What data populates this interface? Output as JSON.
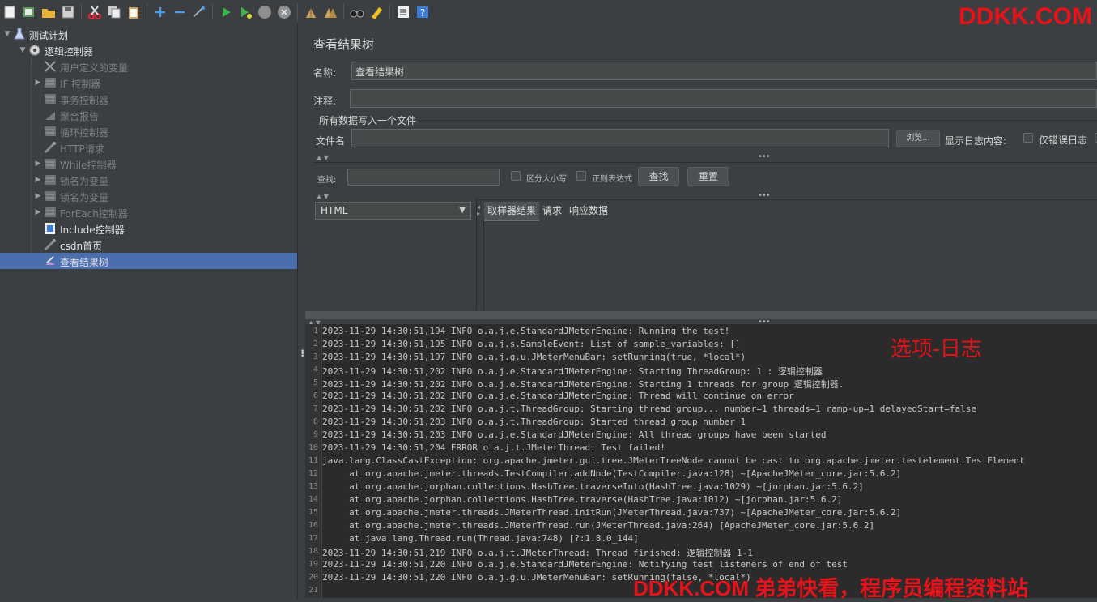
{
  "watermark_top": "DDKK.COM",
  "watermark_bottom": "DDKK.COM 弟弟快看，程序员编程资料站",
  "toolbar": {
    "icons": [
      "new-icon",
      "templates-icon",
      "open-icon",
      "save-icon",
      "cut-icon",
      "copy-icon",
      "paste-icon",
      "expand-icon",
      "collapse-icon",
      "toggle-icon",
      "start-icon",
      "start-no-pause-icon",
      "stop-icon",
      "shutdown-icon",
      "clear-icon",
      "clear-all-icon",
      "search-icon",
      "reset-search-icon",
      "function-helper-icon",
      "help-icon"
    ]
  },
  "tree": {
    "items": [
      {
        "label": "测试计划",
        "icon": "flask-icon",
        "enabled": true,
        "arrow": "down"
      },
      {
        "label": "逻辑控制器",
        "icon": "gear-icon",
        "enabled": true,
        "arrow": "down"
      },
      {
        "label": "用户定义的变量",
        "icon": "wrench-icon",
        "enabled": false,
        "arrow": ""
      },
      {
        "label": "IF 控制器",
        "icon": "controller-icon",
        "enabled": false,
        "arrow": "right"
      },
      {
        "label": "事务控制器",
        "icon": "controller-icon",
        "enabled": false,
        "arrow": ""
      },
      {
        "label": "聚合报告",
        "icon": "report-icon",
        "enabled": false,
        "arrow": ""
      },
      {
        "label": "循环控制器",
        "icon": "controller-icon",
        "enabled": false,
        "arrow": ""
      },
      {
        "label": "HTTP请求",
        "icon": "pipette-icon",
        "enabled": false,
        "arrow": ""
      },
      {
        "label": "While控制器",
        "icon": "controller-icon",
        "enabled": false,
        "arrow": "right"
      },
      {
        "label": "锁名为变量",
        "icon": "controller-icon",
        "enabled": false,
        "arrow": "right"
      },
      {
        "label": "锁名为变量",
        "icon": "controller-icon",
        "enabled": false,
        "arrow": "right"
      },
      {
        "label": "ForEach控制器",
        "icon": "controller-icon",
        "enabled": false,
        "arrow": "right"
      },
      {
        "label": "Include控制器",
        "icon": "include-icon",
        "enabled": true,
        "arrow": ""
      },
      {
        "label": "csdn首页",
        "icon": "pipette-icon",
        "enabled": true,
        "arrow": ""
      },
      {
        "label": "查看结果树",
        "icon": "results-tree-icon",
        "enabled": true,
        "arrow": "",
        "selected": true
      }
    ]
  },
  "panel": {
    "title": "查看结果树",
    "name_label": "名称:",
    "name_value": "查看结果树",
    "comment_label": "注释:",
    "comment_value": "",
    "write_all_label": "所有数据写入一个文件",
    "filename_label": "文件名",
    "filename_value": "",
    "browse_label": "浏览...",
    "log_content_label": "显示日志内容:",
    "errors_only_label": "仅错误日志",
    "search_label": "查找:",
    "search_value": "",
    "case_sensitive_label": "区分大小写",
    "regex_label": "正则表达式",
    "find_button": "查找",
    "reset_button": "重置",
    "renderer_value": "HTML",
    "tabs": [
      "取样器结果",
      "请求",
      "响应数据"
    ]
  },
  "log": {
    "annotation": "选项-日志",
    "lines": [
      "2023-11-29 14:30:51,194 INFO o.a.j.e.StandardJMeterEngine: Running the test!",
      "2023-11-29 14:30:51,195 INFO o.a.j.s.SampleEvent: List of sample_variables: []",
      "2023-11-29 14:30:51,197 INFO o.a.j.g.u.JMeterMenuBar: setRunning(true, *local*)",
      "2023-11-29 14:30:51,202 INFO o.a.j.e.StandardJMeterEngine: Starting ThreadGroup: 1 : 逻辑控制器",
      "2023-11-29 14:30:51,202 INFO o.a.j.e.StandardJMeterEngine: Starting 1 threads for group 逻辑控制器.",
      "2023-11-29 14:30:51,202 INFO o.a.j.e.StandardJMeterEngine: Thread will continue on error",
      "2023-11-29 14:30:51,202 INFO o.a.j.t.ThreadGroup: Starting thread group... number=1 threads=1 ramp-up=1 delayedStart=false",
      "2023-11-29 14:30:51,203 INFO o.a.j.t.ThreadGroup: Started thread group number 1",
      "2023-11-29 14:30:51,203 INFO o.a.j.e.StandardJMeterEngine: All thread groups have been started",
      "2023-11-29 14:30:51,204 ERROR o.a.j.t.JMeterThread: Test failed!",
      "java.lang.ClassCastException: org.apache.jmeter.gui.tree.JMeterTreeNode cannot be cast to org.apache.jmeter.testelement.TestElement",
      "     at org.apache.jmeter.threads.TestCompiler.addNode(TestCompiler.java:128) ~[ApacheJMeter_core.jar:5.6.2]",
      "     at org.apache.jorphan.collections.HashTree.traverseInto(HashTree.java:1029) ~[jorphan.jar:5.6.2]",
      "     at org.apache.jorphan.collections.HashTree.traverse(HashTree.java:1012) ~[jorphan.jar:5.6.2]",
      "     at org.apache.jmeter.threads.JMeterThread.initRun(JMeterThread.java:737) ~[ApacheJMeter_core.jar:5.6.2]",
      "     at org.apache.jmeter.threads.JMeterThread.run(JMeterThread.java:264) [ApacheJMeter_core.jar:5.6.2]",
      "     at java.lang.Thread.run(Thread.java:748) [?:1.8.0_144]",
      "2023-11-29 14:30:51,219 INFO o.a.j.t.JMeterThread: Thread finished: 逻辑控制器 1-1",
      "2023-11-29 14:30:51,220 INFO o.a.j.e.StandardJMeterEngine: Notifying test listeners of end of test",
      "2023-11-29 14:30:51,220 INFO o.a.j.g.u.JMeterMenuBar: setRunning(false, *local*)",
      ""
    ]
  }
}
